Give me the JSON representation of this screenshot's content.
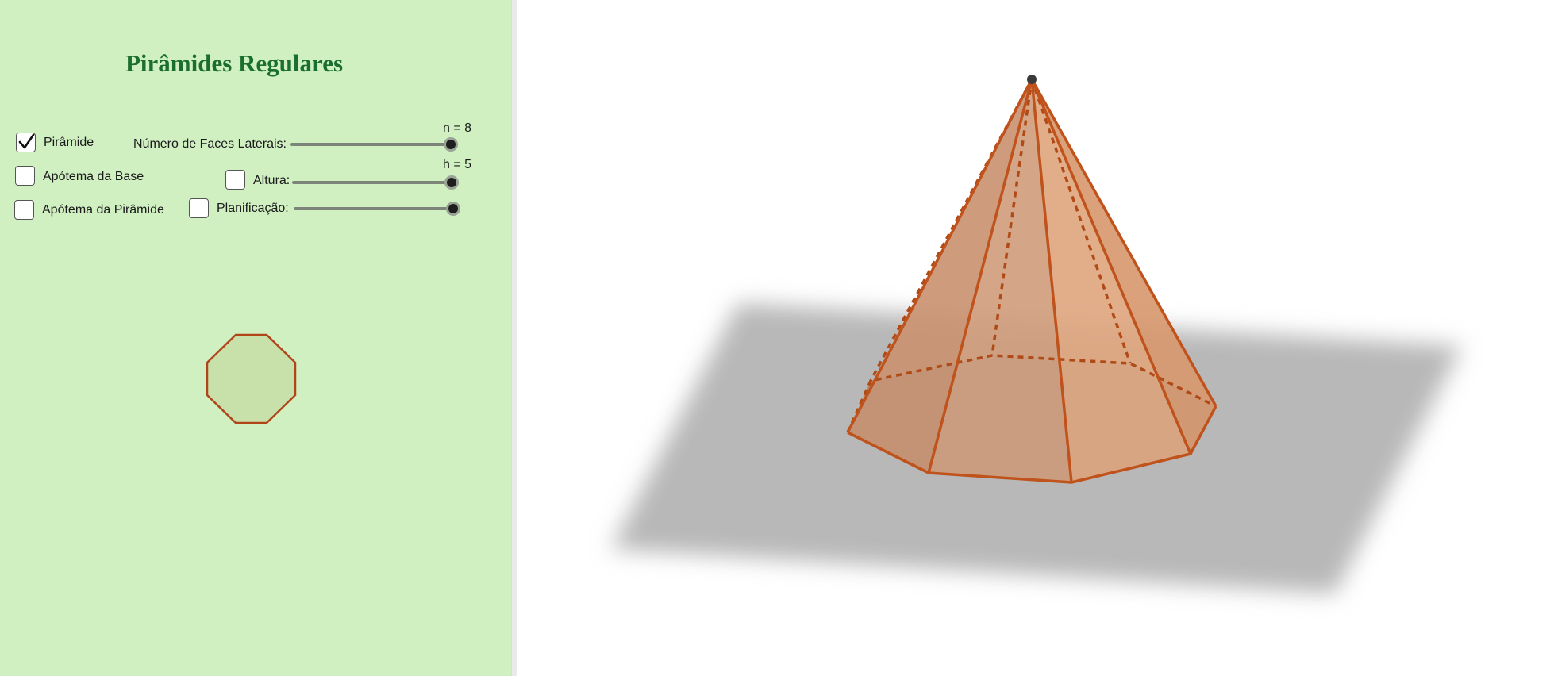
{
  "title": "Pirâmides Regulares",
  "controls": {
    "piramide": {
      "label": "Pirâmide",
      "checked": true
    },
    "apotema_base": {
      "label": "Apótema da Base",
      "checked": false
    },
    "apotema_piramide": {
      "label": "Apótema da Pirâmide",
      "checked": false
    },
    "altura": {
      "label": "Altura:",
      "checked": false
    },
    "planificacao": {
      "label": "Planificação:",
      "checked": false
    }
  },
  "sliders": {
    "n": {
      "label": "Número de Faces Laterais:",
      "value_text": "n = 8",
      "value": 8,
      "position": 1.0
    },
    "h": {
      "value_text": "h = 5",
      "value": 5,
      "position": 1.0
    },
    "planificacao": {
      "position": 1.0
    }
  },
  "colors": {
    "panel_bg": "#d0f0c2",
    "title": "#1a6e2e",
    "pyramid_edge": "#c0521c",
    "pyramid_face": "#d78a5c",
    "plane": "#b8b8b8",
    "octagon_fill": "#c8e0aa",
    "octagon_stroke": "#b2441a"
  },
  "icons": {
    "check": "checkmark-icon"
  }
}
